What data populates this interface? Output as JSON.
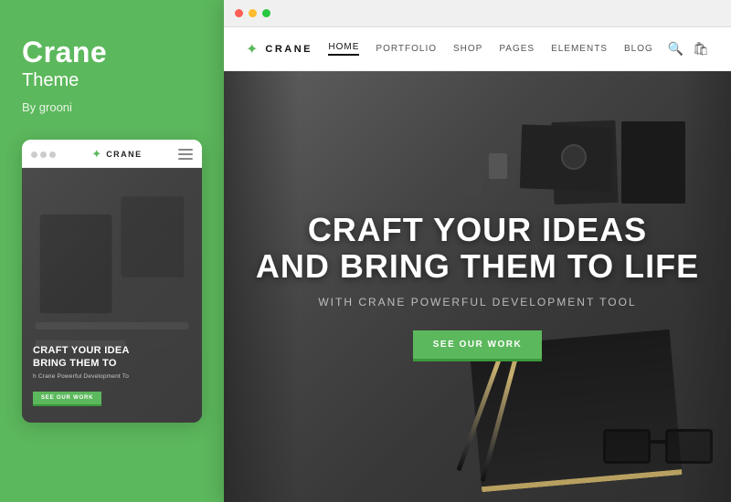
{
  "sidebar": {
    "title": "Crane",
    "subtitle": "Theme",
    "author": "By grooni"
  },
  "mobile": {
    "logo": "CRANE",
    "hero_title_line1": "CRAFT YOUR IDEA",
    "hero_title_line2": "BRING THEM TO",
    "hero_subtitle": "h Crane Powerful Development To",
    "cta_button": "SEE OUR WORK"
  },
  "website": {
    "logo_text": "CRANE",
    "nav_items": [
      "HOME",
      "PORTFOLIO",
      "SHOP",
      "PAGES",
      "ELEMENTS",
      "BLOG"
    ],
    "active_nav": "HOME",
    "hero_title_line1": "CRAFT YOUR IDEAS",
    "hero_title_line2": "AND BRING THEM TO LIFE",
    "hero_subtitle": "With Crane Powerful Development Tool",
    "cta_button": "SEE OUR WORK"
  },
  "colors": {
    "green": "#5cb85c",
    "dark_green": "#3a9a3a",
    "hero_bg": "#454545",
    "white": "#ffffff"
  }
}
